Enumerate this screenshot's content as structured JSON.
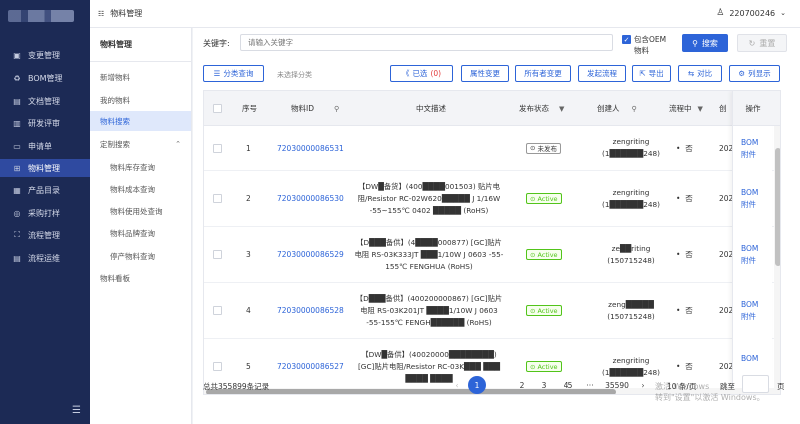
{
  "sidebar": {
    "items": [
      {
        "icon": "▣",
        "icon_name": "grid-icon",
        "label": "变更管理"
      },
      {
        "icon": "♻",
        "icon_name": "bom-icon",
        "label": "BOM管理"
      },
      {
        "icon": "▤",
        "icon_name": "document-icon",
        "label": "文档管理"
      },
      {
        "icon": "▥",
        "icon_name": "review-icon",
        "label": "研发评审"
      },
      {
        "icon": "▭",
        "icon_name": "application-icon",
        "label": "申请单"
      },
      {
        "icon": "⊞",
        "icon_name": "material-icon",
        "label": "物料管理"
      },
      {
        "icon": "▦",
        "icon_name": "catalog-icon",
        "label": "产品目录"
      },
      {
        "icon": "◎",
        "icon_name": "purchase-icon",
        "label": "采购打样"
      },
      {
        "icon": "⛶",
        "icon_name": "flow-icon",
        "label": "流程管理"
      },
      {
        "icon": "▤",
        "icon_name": "ops-icon",
        "label": "流程运维"
      }
    ],
    "collapse_icon": "☰"
  },
  "topbar": {
    "breadcrumb": "物料管理",
    "breadcrumb_icon": "☷",
    "user": "220700246",
    "user_icon": "♙",
    "chevron": "⌄"
  },
  "submenu": {
    "title": "物料管理",
    "items": [
      {
        "label": "新增物料"
      },
      {
        "label": "我的物料"
      },
      {
        "label": "物料搜索"
      },
      {
        "label": "定制搜索",
        "arrow": "⌃"
      },
      {
        "label": "物料库存查询"
      },
      {
        "label": "物料成本查询"
      },
      {
        "label": "物料使用处查询"
      },
      {
        "label": "物料品牌查询"
      },
      {
        "label": "停产物料查询"
      },
      {
        "label": "物料看板"
      }
    ]
  },
  "search": {
    "keyword_label": "关键字:",
    "placeholder": "请输入关键字",
    "oem_label": "包含OEM物料",
    "oem_check": "✓",
    "search_label": "搜索",
    "search_icon": "⚲",
    "reset_label": "重置",
    "reset_icon": "↻"
  },
  "toolbar": {
    "classify_icon": "☰",
    "classify_label": "分类查询",
    "unselected": "未选择分类",
    "selected_icon": "《",
    "selected_label": "已选",
    "selected_count": "(0)",
    "attr_change": "属性变更",
    "owner_change": "所有者变更",
    "start_flow": "发起流程",
    "export_icon": "⇱",
    "export_label": "导出",
    "compare_icon": "⇆",
    "compare_label": "对比",
    "columns_icon": "⚙",
    "columns_label": "列显示"
  },
  "table": {
    "headers": {
      "seq": "序号",
      "material_id": "物料ID",
      "description": "中文描述",
      "status": "发布状态",
      "creator": "创建人",
      "flow": "流程中",
      "created": "创",
      "operation": "操作"
    },
    "sort_icon": "⚲",
    "filter_icon": "▼",
    "rows": [
      {
        "seq": "1",
        "id": "72030000086531",
        "desc": "",
        "status": "未发布",
        "status_icon": "⊙",
        "creator1": "zengriting",
        "creator2": "(1██████248)",
        "flow": "否",
        "created": "202",
        "ops": [
          "BOM",
          "附件"
        ]
      },
      {
        "seq": "2",
        "id": "72030000086530",
        "desc": "【DW█备货】(400████001503) 贴片电阻/Resistor RC-02W620█████ J 1/16W -55~155℃ 0402 █████ (RoHS)",
        "status": "Active",
        "status_icon": "⊙",
        "creator1": "zengriting",
        "creator2": "(1██████248)",
        "flow": "否",
        "created": "202",
        "ops": [
          "BOM",
          "附件"
        ]
      },
      {
        "seq": "3",
        "id": "72030000086529",
        "desc": "【D███备供】(4████000877) [GC]贴片电阻 RS-03K333JT ███1/10W J 0603 -55-155℃ FENGHUA (RoHS)",
        "status": "Active",
        "status_icon": "⊙",
        "creator1": "ze██riting",
        "creator2": "(150715248)",
        "flow": "否",
        "created": "202",
        "ops": [
          "BOM",
          "附件"
        ]
      },
      {
        "seq": "4",
        "id": "72030000086528",
        "desc": "【D███备供】(400200000867) [GC]贴片电阻 RS-03K201JT ████1/10W J 0603 -55-155℃ FENGH██████ (RoHS)",
        "status": "Active",
        "status_icon": "⊙",
        "creator1": "zeng█████",
        "creator2": "(150715248)",
        "flow": "否",
        "created": "202",
        "ops": [
          "BOM",
          "附件"
        ]
      },
      {
        "seq": "5",
        "id": "72030000086527",
        "desc": "【DW█备供】(40020000████████) [GC]贴片电阻/Resistor RC-03K███ ███ ████ ████",
        "status": "Active",
        "status_icon": "⊙",
        "creator1": "zengriting",
        "creator2": "(1██████248)",
        "flow": "否",
        "created": "202",
        "ops": [
          "BOM"
        ]
      }
    ]
  },
  "pagination": {
    "total": "总共355899条记录",
    "prev": "‹",
    "next": "›",
    "pages": [
      "1",
      "2",
      "3",
      "4",
      "5",
      "···",
      "35590"
    ],
    "page_size": "10 条/页",
    "jump_label": "跳至",
    "jump_unit": "页"
  },
  "watermark": {
    "line1": "激活 Windows",
    "line2": "转到\"设置\"以激活 Windows。"
  }
}
